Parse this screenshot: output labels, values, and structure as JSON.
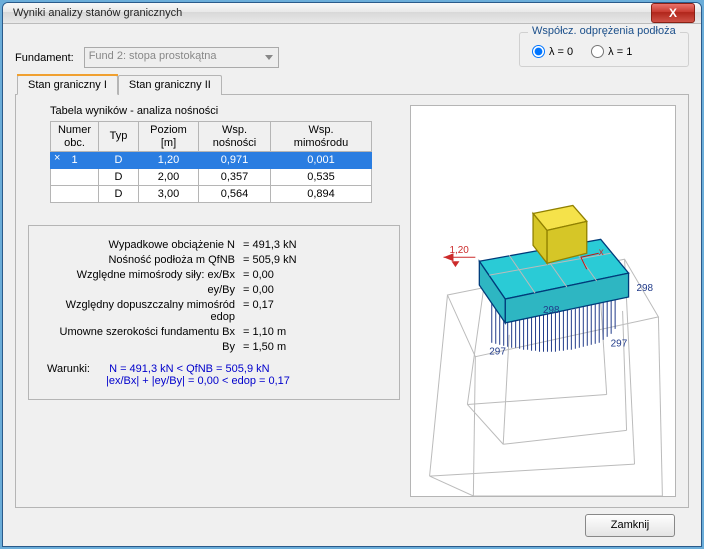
{
  "window": {
    "title": "Wyniki analizy stanów granicznych"
  },
  "fundament": {
    "label": "Fundament:",
    "value": "Fund 2: stopa prostokątna"
  },
  "group_odprezenie": {
    "legend": "Współcz. odprężenia podłoża",
    "opt0": "λ = 0",
    "opt1": "λ = 1",
    "selected": 0
  },
  "tabs": {
    "tab1": "Stan graniczny I",
    "tab2": "Stan graniczny II"
  },
  "table": {
    "caption": "Tabela wyników - analiza nośności",
    "headers": {
      "c0": "Numer\nobc.",
      "c1": "Typ",
      "c2": "Poziom\n[m]",
      "c3": "Wsp.\nnośności",
      "c4": "Wsp.\nmimośrodu"
    },
    "rows": [
      {
        "c0": "1",
        "c1": "D",
        "c2": "1,20",
        "c3": "0,971",
        "c4": "0,001",
        "selected": true
      },
      {
        "c0": "",
        "c1": "D",
        "c2": "2,00",
        "c3": "0,357",
        "c4": "0,535",
        "selected": false
      },
      {
        "c0": "",
        "c1": "D",
        "c2": "3,00",
        "c3": "0,564",
        "c4": "0,894",
        "selected": false
      }
    ]
  },
  "results": {
    "l0": {
      "lab": "Wypadkowe obciążenie  N",
      "val": "= 491,3 kN"
    },
    "l1": {
      "lab": "Nośność podłoża  m QfNB",
      "val": "= 505,9 kN"
    },
    "l2": {
      "lab": "Względne mimośrody siły:  ex/Bx",
      "val": "= 0,00"
    },
    "l3": {
      "lab": "ey/By",
      "val": "= 0,00"
    },
    "l4": {
      "lab": "Względny dopuszczalny mimośród  edop",
      "val": "= 0,17"
    },
    "l5": {
      "lab": "Umowne szerokości fundamentu  Bx",
      "val": "= 1,10 m"
    },
    "l6": {
      "lab": "By",
      "val": "= 1,50 m"
    }
  },
  "conditions": {
    "label": "Warunki:",
    "line1": "N = 491,3 kN < QfNB = 505,9 kN",
    "line2": "|ex/Bx| + |ey/By| = 0,00 < edop = 0,17"
  },
  "viewer_labels": {
    "depth": "1,20",
    "front": "298",
    "right": "298",
    "leftbot": "297",
    "rightbot": "297"
  },
  "buttons": {
    "close": "Zamknij"
  },
  "close_x": "X"
}
